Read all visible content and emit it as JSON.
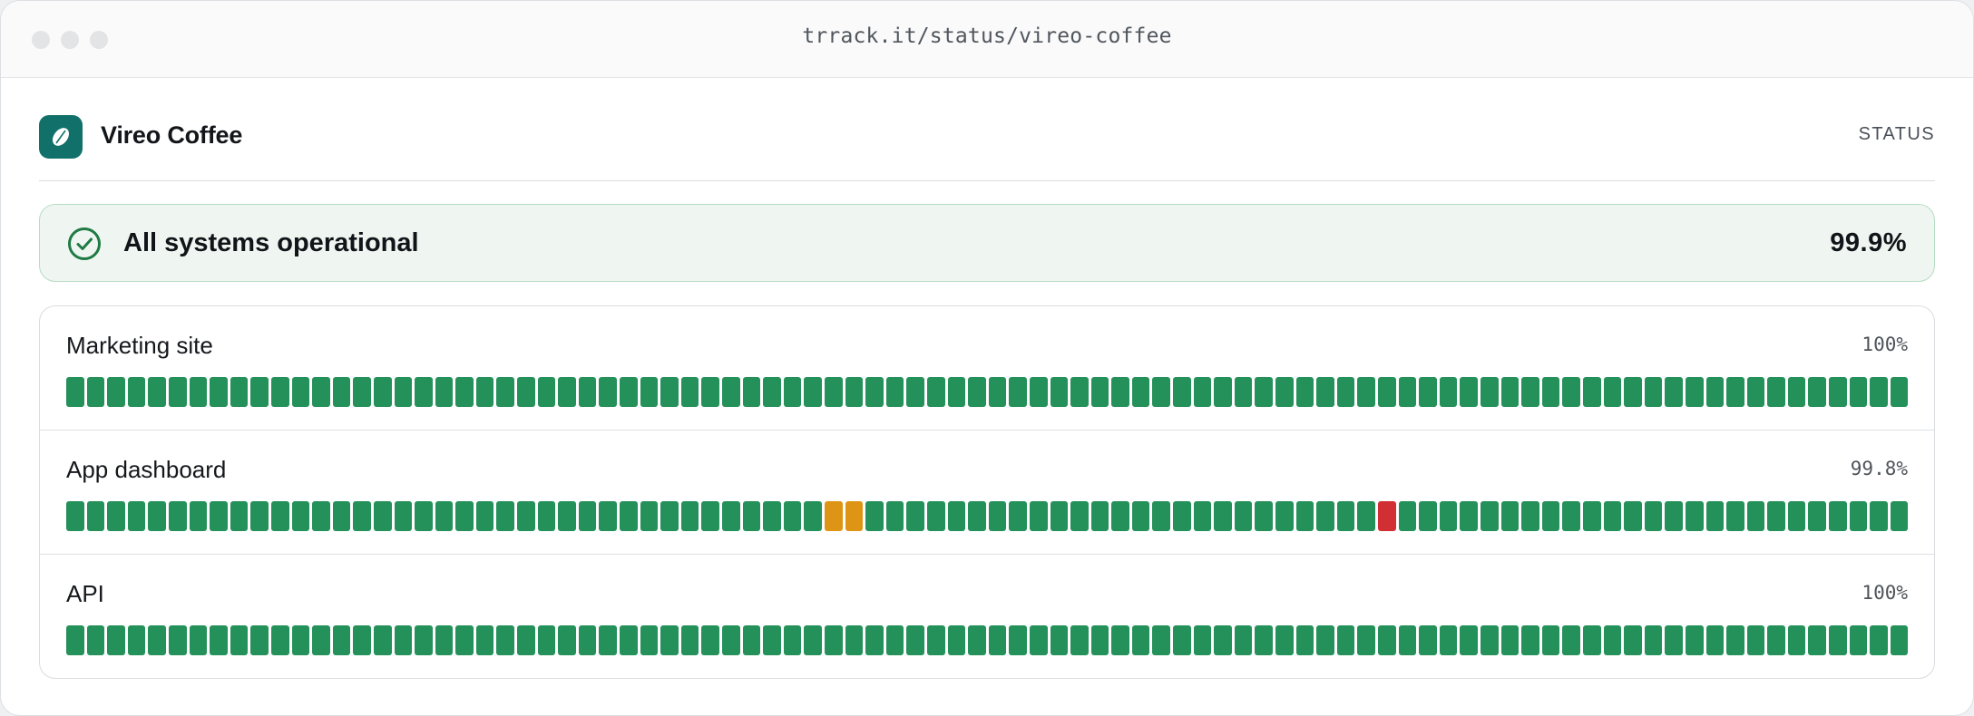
{
  "browser": {
    "url": "trrack.it/status/vireo-coffee"
  },
  "header": {
    "brand_name": "Vireo Coffee",
    "status_label": "STATUS",
    "logo_icon": "coffee-bean-icon",
    "brand_color": "#12706a"
  },
  "banner": {
    "text": "All systems operational",
    "uptime": "99.9%",
    "icon": "check-circle-icon",
    "color": "#1f7a45"
  },
  "colors": {
    "operational": "#25915a",
    "degraded": "#de9516",
    "outage": "#d12f34"
  },
  "services": [
    {
      "name": "Marketing site",
      "uptime": "100%",
      "days": [
        "ok",
        "ok",
        "ok",
        "ok",
        "ok",
        "ok",
        "ok",
        "ok",
        "ok",
        "ok",
        "ok",
        "ok",
        "ok",
        "ok",
        "ok",
        "ok",
        "ok",
        "ok",
        "ok",
        "ok",
        "ok",
        "ok",
        "ok",
        "ok",
        "ok",
        "ok",
        "ok",
        "ok",
        "ok",
        "ok",
        "ok",
        "ok",
        "ok",
        "ok",
        "ok",
        "ok",
        "ok",
        "ok",
        "ok",
        "ok",
        "ok",
        "ok",
        "ok",
        "ok",
        "ok",
        "ok",
        "ok",
        "ok",
        "ok",
        "ok",
        "ok",
        "ok",
        "ok",
        "ok",
        "ok",
        "ok",
        "ok",
        "ok",
        "ok",
        "ok",
        "ok",
        "ok",
        "ok",
        "ok",
        "ok",
        "ok",
        "ok",
        "ok",
        "ok",
        "ok",
        "ok",
        "ok",
        "ok",
        "ok",
        "ok",
        "ok",
        "ok",
        "ok",
        "ok",
        "ok",
        "ok",
        "ok",
        "ok",
        "ok",
        "ok",
        "ok",
        "ok",
        "ok",
        "ok",
        "ok"
      ]
    },
    {
      "name": "App dashboard",
      "uptime": "99.8%",
      "days": [
        "ok",
        "ok",
        "ok",
        "ok",
        "ok",
        "ok",
        "ok",
        "ok",
        "ok",
        "ok",
        "ok",
        "ok",
        "ok",
        "ok",
        "ok",
        "ok",
        "ok",
        "ok",
        "ok",
        "ok",
        "ok",
        "ok",
        "ok",
        "ok",
        "ok",
        "ok",
        "ok",
        "ok",
        "ok",
        "ok",
        "ok",
        "ok",
        "ok",
        "ok",
        "ok",
        "ok",
        "ok",
        "degraded",
        "degraded",
        "ok",
        "ok",
        "ok",
        "ok",
        "ok",
        "ok",
        "ok",
        "ok",
        "ok",
        "ok",
        "ok",
        "ok",
        "ok",
        "ok",
        "ok",
        "ok",
        "ok",
        "ok",
        "ok",
        "ok",
        "ok",
        "ok",
        "ok",
        "ok",
        "ok",
        "outage",
        "ok",
        "ok",
        "ok",
        "ok",
        "ok",
        "ok",
        "ok",
        "ok",
        "ok",
        "ok",
        "ok",
        "ok",
        "ok",
        "ok",
        "ok",
        "ok",
        "ok",
        "ok",
        "ok",
        "ok",
        "ok",
        "ok",
        "ok",
        "ok",
        "ok"
      ]
    },
    {
      "name": "API",
      "uptime": "100%",
      "days": [
        "ok",
        "ok",
        "ok",
        "ok",
        "ok",
        "ok",
        "ok",
        "ok",
        "ok",
        "ok",
        "ok",
        "ok",
        "ok",
        "ok",
        "ok",
        "ok",
        "ok",
        "ok",
        "ok",
        "ok",
        "ok",
        "ok",
        "ok",
        "ok",
        "ok",
        "ok",
        "ok",
        "ok",
        "ok",
        "ok",
        "ok",
        "ok",
        "ok",
        "ok",
        "ok",
        "ok",
        "ok",
        "ok",
        "ok",
        "ok",
        "ok",
        "ok",
        "ok",
        "ok",
        "ok",
        "ok",
        "ok",
        "ok",
        "ok",
        "ok",
        "ok",
        "ok",
        "ok",
        "ok",
        "ok",
        "ok",
        "ok",
        "ok",
        "ok",
        "ok",
        "ok",
        "ok",
        "ok",
        "ok",
        "ok",
        "ok",
        "ok",
        "ok",
        "ok",
        "ok",
        "ok",
        "ok",
        "ok",
        "ok",
        "ok",
        "ok",
        "ok",
        "ok",
        "ok",
        "ok",
        "ok",
        "ok",
        "ok",
        "ok",
        "ok",
        "ok",
        "ok",
        "ok",
        "ok",
        "ok"
      ]
    }
  ]
}
